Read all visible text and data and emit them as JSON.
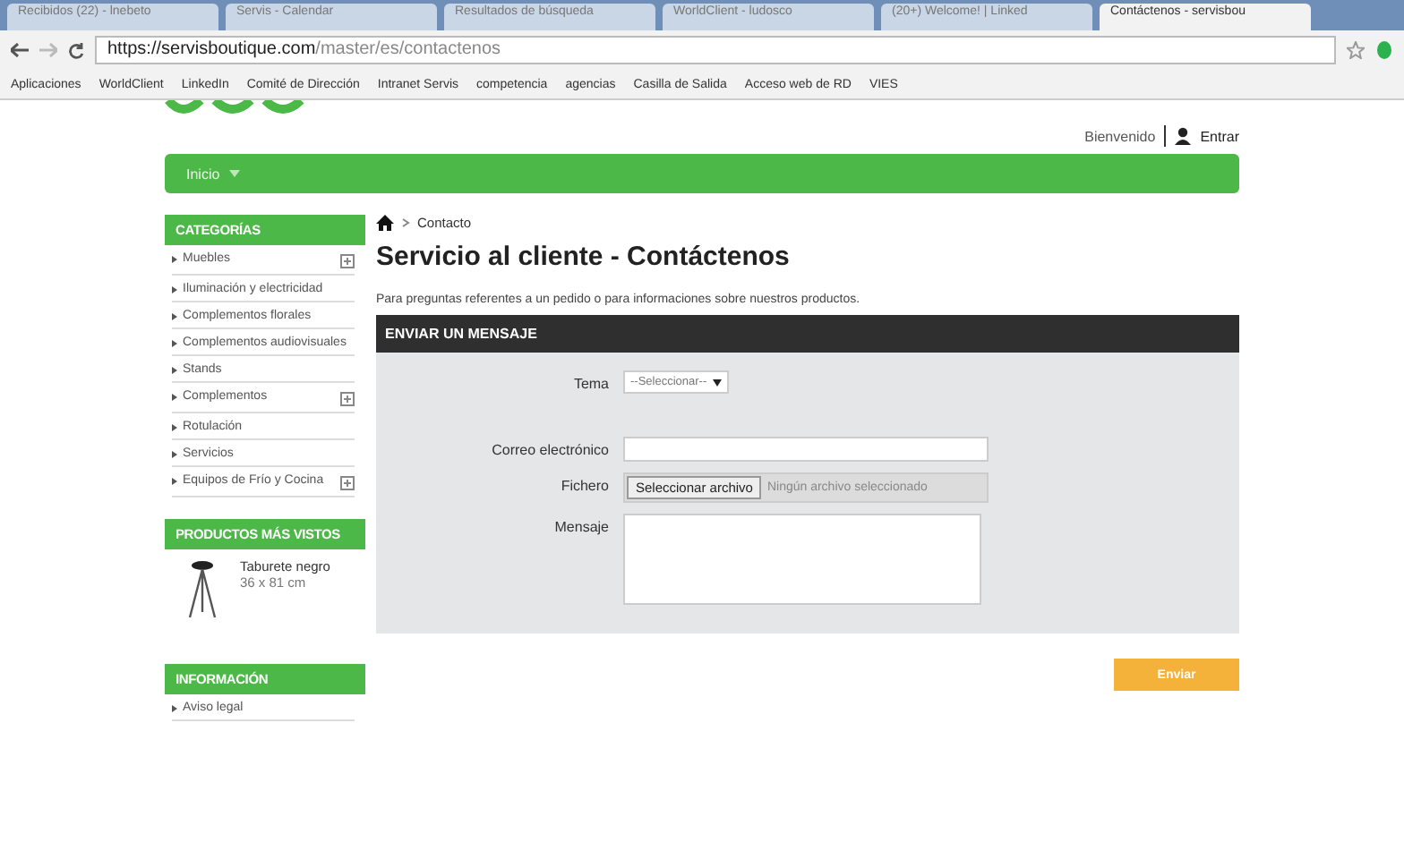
{
  "browser": {
    "tabs": [
      {
        "title": "Recibidos (22) - lnebeto",
        "selected": false
      },
      {
        "title": "Servis - Calendar",
        "selected": false
      },
      {
        "title": "Resultados de búsqueda",
        "selected": false
      },
      {
        "title": "WorldClient - ludosco",
        "selected": false
      },
      {
        "title": "(20+) Welcome! | Linked",
        "selected": false
      },
      {
        "title": "Contáctenos - servisbou",
        "selected": true
      }
    ],
    "url_host": "https://servisboutique.com",
    "url_path": "/master/es/contactenos",
    "bookmarks": [
      "Aplicaciones",
      "WorldClient",
      "LinkedIn",
      "Comité de Dirección",
      "Intranet Servis",
      "competencia",
      "agencias",
      "Casilla de Salida",
      "Acceso web de RD",
      "VIES"
    ]
  },
  "header": {
    "welcome": "Bienvenido",
    "login": "Entrar"
  },
  "nav": {
    "label": "Inicio"
  },
  "sidebar": {
    "categories_title": "CATEGORÍAS",
    "categories": [
      {
        "label": "Muebles",
        "expandable": true
      },
      {
        "label": "Iluminación y electricidad",
        "expandable": false
      },
      {
        "label": "Complementos florales",
        "expandable": false
      },
      {
        "label": "Complementos audiovisuales",
        "expandable": false
      },
      {
        "label": "Stands",
        "expandable": false
      },
      {
        "label": "Complementos",
        "expandable": true
      },
      {
        "label": "Rotulación",
        "expandable": false
      },
      {
        "label": "Servicios",
        "expandable": false
      },
      {
        "label": "Equipos de Frío y Cocina",
        "expandable": true
      }
    ],
    "top_products_title": "PRODUCTOS MÁS VISTOS",
    "product": {
      "name": "Taburete negro",
      "size": "36 x 81 cm"
    },
    "info_title": "INFORMACIÓN",
    "info_items": [
      "Aviso legal"
    ]
  },
  "breadcrumb": "Contacto",
  "title": "Servicio al cliente - Contáctenos",
  "intro": "Para preguntas referentes a un pedido o para informaciones sobre nuestros productos.",
  "form": {
    "heading": "ENVIAR UN MENSAJE",
    "subject_label": "Tema",
    "subject_value": "--Seleccionar--",
    "email_label": "Correo electrónico",
    "file_label": "Fichero",
    "file_button": "Seleccionar archivo",
    "file_status": "Ningún archivo seleccionado",
    "message_label": "Mensaje",
    "submit": "Enviar"
  }
}
